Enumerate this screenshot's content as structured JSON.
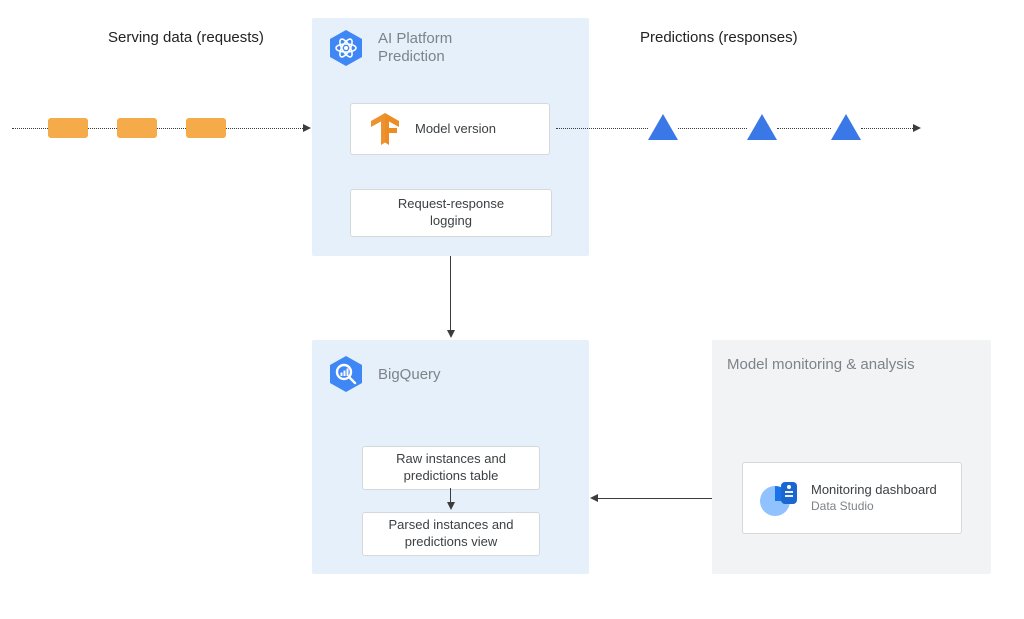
{
  "labels": {
    "serving": "Serving data (requests)",
    "predictions": "Predictions (responses)"
  },
  "panels": {
    "aip": {
      "title_l1": "AI Platform",
      "title_l2": "Prediction",
      "card_model": "Model version",
      "card_logging_l1": "Request-response",
      "card_logging_l2": "logging"
    },
    "bq": {
      "title": "BigQuery",
      "card_raw_l1": "Raw instances and",
      "card_raw_l2": "predictions table",
      "card_parsed_l1": "Parsed instances and",
      "card_parsed_l2": "predictions view"
    },
    "mon": {
      "title": "Model monitoring & analysis",
      "card_dash_l1": "Monitoring dashboard",
      "card_dash_l2": "Data Studio"
    }
  },
  "colors": {
    "panel_blue": "#e5f0fa",
    "panel_grey": "#f1f3f4",
    "orange": "#f6ab4a",
    "blue_tri": "#3b78e7",
    "hex_blue": "#3f86f6",
    "tf_orange": "#ec8c23",
    "ds_blue": "#1a73e8"
  }
}
